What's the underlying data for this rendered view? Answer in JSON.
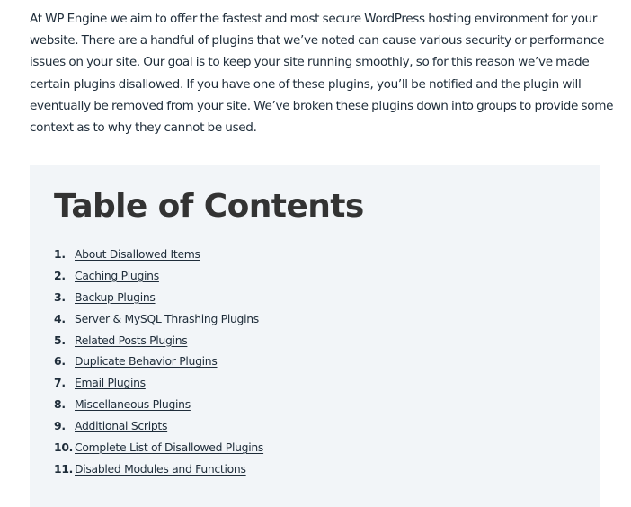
{
  "intro": {
    "text": "At WP Engine we aim to offer the fastest and most secure WordPress hosting environment for your website. There are a handful of plugins that we’ve noted can cause various security or performance issues on your site. Our goal is to keep your site running smoothly, so for this reason we’ve made certain plugins disallowed. If you have one of these plugins, you’ll be notified and the plugin will eventually be removed from your site. We’ve broken these plugins down into groups to provide some context as to why they cannot be used."
  },
  "toc": {
    "title": "Table of Contents",
    "items": [
      {
        "num": "1.",
        "label": "About Disallowed Items"
      },
      {
        "num": "2.",
        "label": "Caching Plugins"
      },
      {
        "num": "3.",
        "label": "Backup Plugins"
      },
      {
        "num": "4.",
        "label": "Server & MySQL Thrashing Plugins"
      },
      {
        "num": "5.",
        "label": "Related Posts Plugins"
      },
      {
        "num": "6.",
        "label": "Duplicate Behavior Plugins"
      },
      {
        "num": "7.",
        "label": "Email Plugins"
      },
      {
        "num": "8.",
        "label": "Miscellaneous Plugins"
      },
      {
        "num": "9.",
        "label": "Additional Scripts"
      },
      {
        "num": "10.",
        "label": "Complete List of Disallowed Plugins"
      },
      {
        "num": "11.",
        "label": "Disabled Modules and Functions"
      }
    ]
  },
  "colors": {
    "text": "#1f2d3a",
    "heading": "#333333",
    "toc_background": "#f2f5f8"
  }
}
